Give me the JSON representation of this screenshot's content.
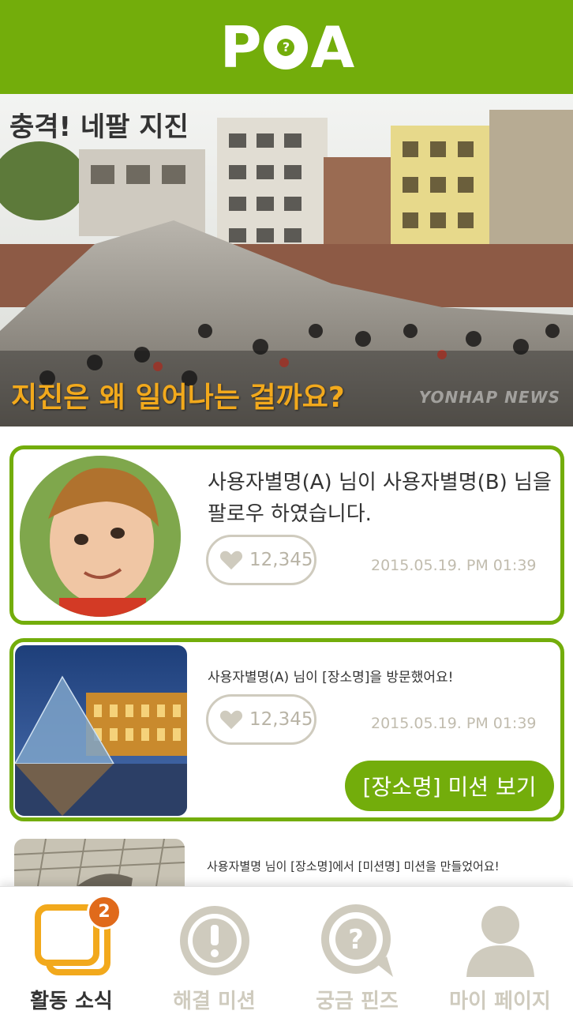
{
  "app": {
    "logo": "POA"
  },
  "banner": {
    "title": "충격! 네팔 지진",
    "question": "지진은 왜 일어나는 걸까요?",
    "watermark": "YONHAP NEWS"
  },
  "feed": [
    {
      "message": "사용자별명(A) 님이 사용자별명(B) 님을 팔로우 하였습니다.",
      "likes": "12,345",
      "date": "2015.05.19. PM 01:39"
    },
    {
      "message": "사용자별명(A) 님이 [장소명]을 방문했어요!",
      "likes": "12,345",
      "date": "2015.05.19. PM 01:39",
      "button": "[장소명] 미션 보기"
    },
    {
      "message": "사용자별명 님이 [장소명]에서 [미션명] 미션을 만들었어요!"
    }
  ],
  "tabs": [
    {
      "label": "활동 소식",
      "icon": "activity-icon",
      "badge": "2",
      "active": true
    },
    {
      "label": "해결 미션",
      "icon": "exclamation-icon",
      "active": false
    },
    {
      "label": "궁금 핀즈",
      "icon": "question-bubble-icon",
      "active": false
    },
    {
      "label": "마이 페이지",
      "icon": "person-icon",
      "active": false
    }
  ],
  "colors": {
    "brand": "#73ad0b",
    "accent": "#f2a91c",
    "badge": "#e06a1b",
    "muted": "#cfcbbe"
  }
}
